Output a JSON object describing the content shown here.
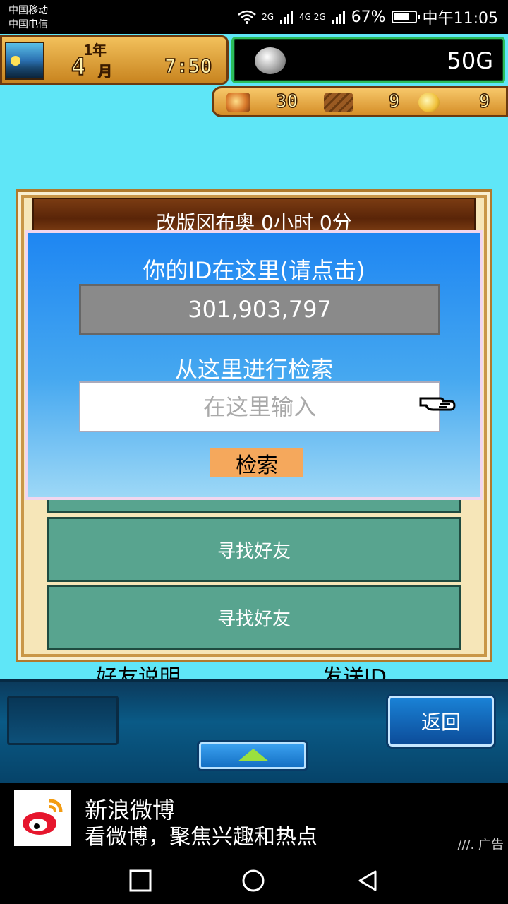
{
  "status_bar": {
    "carrier_1": "中国移动",
    "carrier_2": "中国电信",
    "signal_1": "2G",
    "signal_2": "4G 2G",
    "battery": "67%",
    "time": "中午11:05"
  },
  "hud": {
    "year": "1年",
    "month_num": "4",
    "month_label": "月",
    "time": "7:50",
    "money": "50G",
    "resources": [
      {
        "name": "fish-icon",
        "value": "30"
      },
      {
        "name": "wood-icon",
        "value": "9"
      },
      {
        "name": "medal-icon",
        "value": "9"
      }
    ]
  },
  "dialog": {
    "title": "改版冈布奥  0小时 0分",
    "id_prompt": "你的ID在这里(请点击)",
    "player_id": "301,903,797",
    "search_prompt": "从这里进行检索",
    "search_placeholder": "在这里输入",
    "search_button": "检索"
  },
  "list": {
    "items": [
      "寻找好友",
      "寻找好友"
    ]
  },
  "bottom": {
    "friend_info": "好友说明",
    "send_id": "发送ID",
    "back": "返回"
  },
  "ad": {
    "title": "新浪微博",
    "subtitle": "看微博，聚焦兴趣和热点",
    "tag": "广告"
  }
}
